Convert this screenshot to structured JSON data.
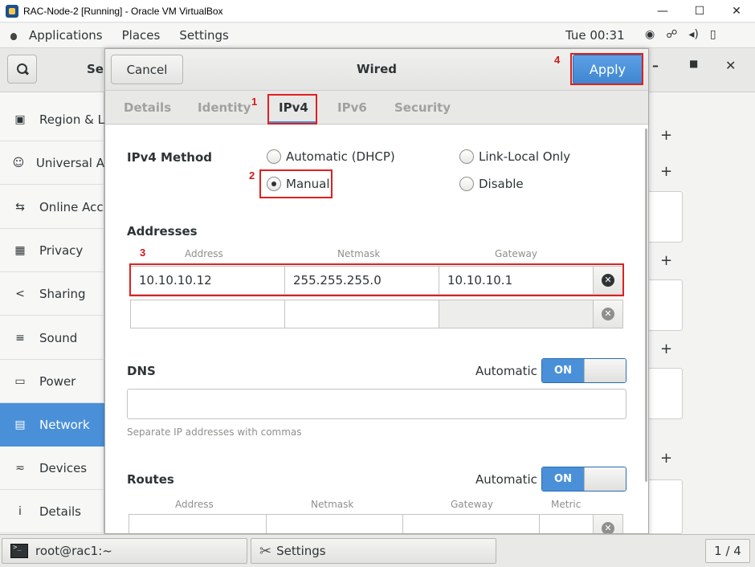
{
  "host_window": {
    "title": "RAC-Node-2 [Running] - Oracle VM VirtualBox",
    "minimize": "—",
    "maximize": "☐",
    "close": "✕"
  },
  "top_bar": {
    "applications": "Applications",
    "places": "Places",
    "settings": "Settings",
    "clock": "Tue 00:31",
    "tray_icons": [
      "accessibility-icon",
      "network-icon",
      "volume-icon",
      "battery-icon"
    ]
  },
  "settings_window": {
    "title_partial": "Se",
    "sidebar": [
      {
        "icon": "region-icon",
        "glyph": "▣",
        "label": "Region & L"
      },
      {
        "icon": "universal-access-icon",
        "glyph": "☺",
        "label": "Universal A"
      },
      {
        "icon": "online-accounts-icon",
        "glyph": "⇆",
        "label": "Online Acc"
      },
      {
        "icon": "privacy-icon",
        "glyph": "▦",
        "label": "Privacy"
      },
      {
        "icon": "sharing-icon",
        "glyph": "<",
        "label": "Sharing"
      },
      {
        "icon": "sound-icon",
        "glyph": "≡",
        "label": "Sound"
      },
      {
        "icon": "power-icon",
        "glyph": "▭",
        "label": "Power"
      },
      {
        "icon": "network-icon",
        "glyph": "▤",
        "label": "Network",
        "active": true
      },
      {
        "icon": "devices-icon",
        "glyph": "≂",
        "label": "Devices"
      },
      {
        "icon": "details-icon",
        "glyph": "i",
        "label": "Details"
      }
    ]
  },
  "dialog": {
    "cancel": "Cancel",
    "title": "Wired",
    "apply": "Apply",
    "tabs": [
      "Details",
      "Identity",
      "IPv4",
      "IPv6",
      "Security"
    ],
    "active_tab": "IPv4",
    "ipv4_method_label": "IPv4 Method",
    "methods": [
      {
        "label": "Automatic (DHCP)",
        "checked": false
      },
      {
        "label": "Link-Local Only",
        "checked": false
      },
      {
        "label": "Manual",
        "checked": true
      },
      {
        "label": "Disable",
        "checked": false
      }
    ],
    "addresses": {
      "label": "Addresses",
      "columns": [
        "Address",
        "Netmask",
        "Gateway"
      ],
      "rows": [
        {
          "address": "10.10.10.12",
          "netmask": "255.255.255.0",
          "gateway": "10.10.10.1"
        },
        {
          "address": "",
          "netmask": "",
          "gateway": ""
        }
      ]
    },
    "dns": {
      "label": "DNS",
      "automatic_label": "Automatic",
      "toggle": "ON",
      "value": "",
      "hint": "Separate IP addresses with commas"
    },
    "routes": {
      "label": "Routes",
      "automatic_label": "Automatic",
      "toggle": "ON",
      "columns": [
        "Address",
        "Netmask",
        "Gateway",
        "Metric"
      ]
    }
  },
  "annotations": [
    "1",
    "2",
    "3",
    "4"
  ],
  "taskbar": {
    "terminal": "root@rac1:~",
    "settings": "Settings",
    "workspace": "1 / 4"
  },
  "colors": {
    "accent": "#4a90d9",
    "annotation": "#e02020"
  }
}
